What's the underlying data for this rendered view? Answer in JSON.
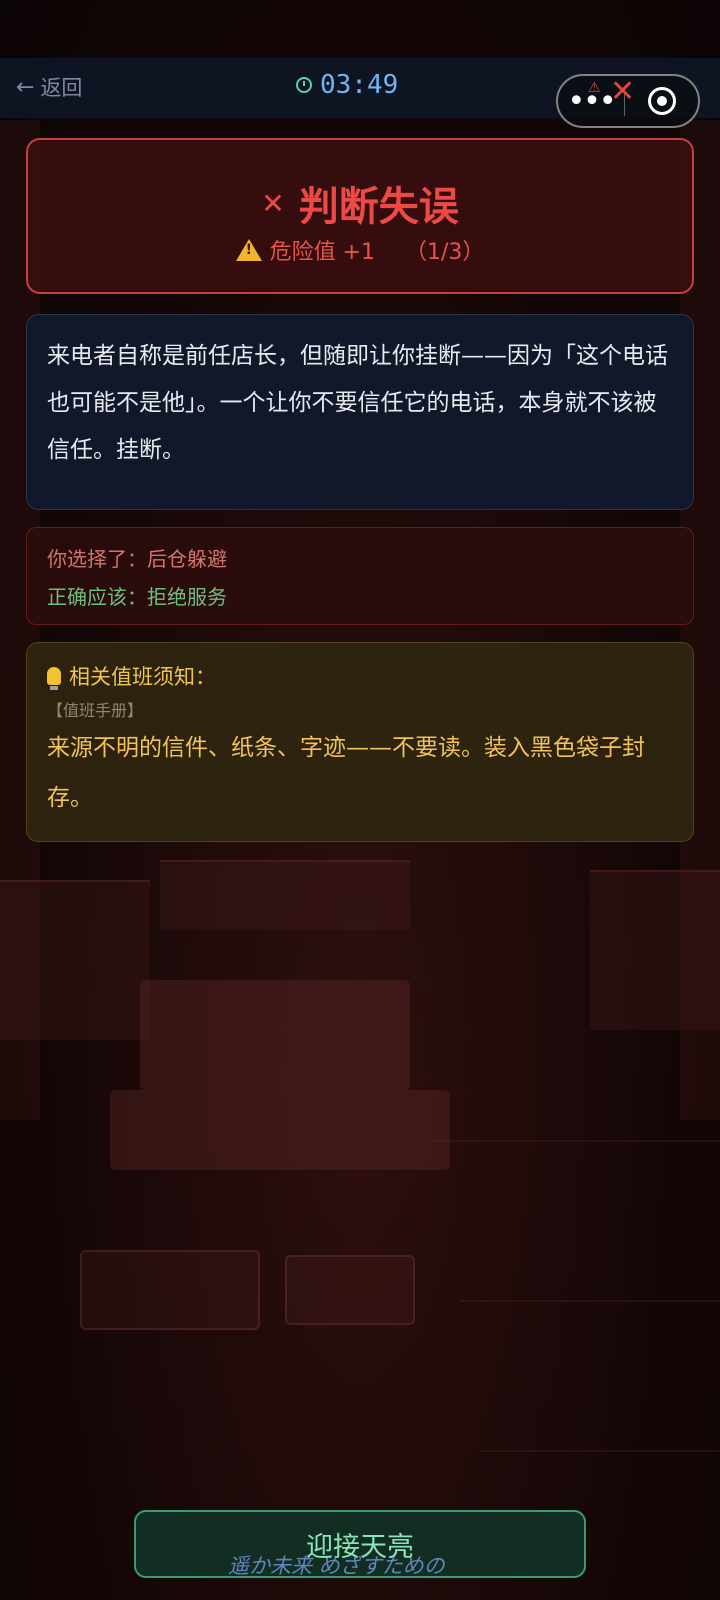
{
  "nav": {
    "back_arrow": "←",
    "back_label": "返回",
    "timer": "03:49"
  },
  "capsule": {
    "more_label": "•••"
  },
  "result": {
    "x_mark": "✕",
    "title": "判断失误",
    "danger_label": "危险值 +1",
    "danger_count": "（1/3）"
  },
  "explanation": {
    "text": "来电者自称是前任店长，但随即让你挂断——因为「这个电话也可能不是他」。一个让你不要信任它的电话，本身就不该被信任。挂断。"
  },
  "choice": {
    "chosen": "你选择了：后仓躲避",
    "correct": "正确应该：拒绝服务"
  },
  "tip": {
    "title": "相关值班须知：",
    "source": "【值班手册】",
    "body": "来源不明的信件、纸条、字迹——不要读。装入黑色袋子封存。"
  },
  "action": {
    "button_label": "迎接天亮"
  },
  "watermark": "遥か未来 めざすための",
  "colors": {
    "error_red": "#ec4a45",
    "correct_green": "#6fbf7a",
    "tip_gold": "#f1c35a",
    "timer_blue": "#6fb6f0"
  }
}
